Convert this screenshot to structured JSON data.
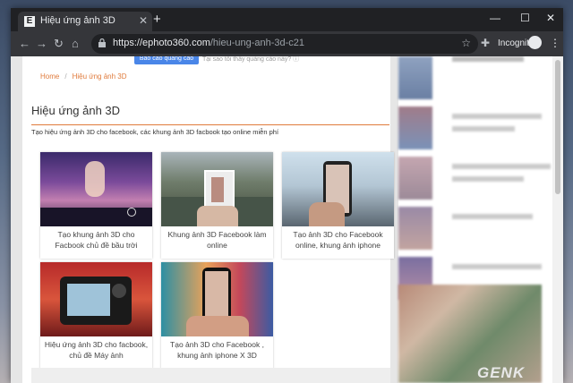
{
  "tab": {
    "favicon": "E",
    "title": "Hiệu ứng ảnh 3D"
  },
  "window": {
    "minimize": "—",
    "maximize": "☐",
    "close": "✕"
  },
  "address": {
    "url_host": "https://ephoto360.com",
    "url_path": "/hieu-ung-anh-3d-c21",
    "profile": "Incognito"
  },
  "ad": {
    "button": "Báo cáo quảng cáo này",
    "text": "Tại sao tôi thấy quảng cáo này? ⓘ"
  },
  "breadcrumb": {
    "home": "Home",
    "separator": "/",
    "current": "Hiệu ứng ảnh 3D"
  },
  "page": {
    "title": "Hiệu ứng ảnh 3D",
    "description": "Tạo hiệu ứng ảnh 3D cho facebook, các khung ảnh 3D facbook tạo online miễn phí"
  },
  "cards": [
    {
      "caption": "Tạo khung ảnh 3D cho Facbook chủ đề bầu trời"
    },
    {
      "caption": "Khung ảnh 3D Facebook làm online"
    },
    {
      "caption": "Tạo ảnh 3D cho Facebook online, khung ảnh iphone"
    },
    {
      "caption": "Hiệu ứng ảnh 3D cho facbook, chủ đề Máy ảnh"
    },
    {
      "caption": "Tạo ảnh 3D cho Facebook , khung ảnh iphone X 3D"
    }
  ],
  "watermark": "GENK",
  "colors": {
    "accent": "#e07b3c",
    "chrome": "#202124",
    "toolbar": "#35363a",
    "adbutton": "#4a86e8"
  }
}
